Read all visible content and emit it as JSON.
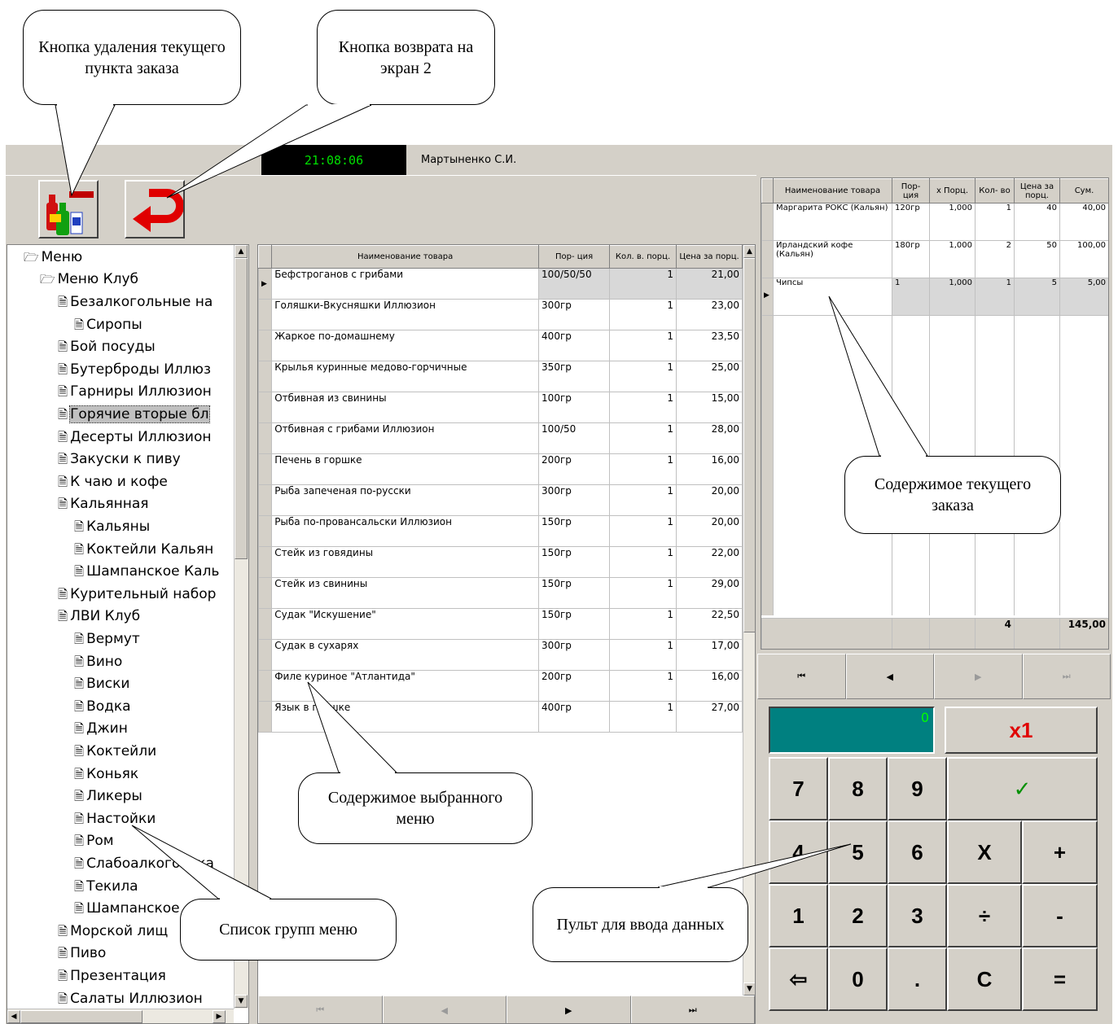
{
  "header": {
    "clock": "21:08:06",
    "user": "Мартыненко С.И."
  },
  "toolbar": {
    "delete_icon": "bottles-minus-icon",
    "back_icon": "red-return-arrow-icon"
  },
  "tree": {
    "root": "Меню",
    "club": "Меню Клуб",
    "items": [
      {
        "label": "Безалкогольные на",
        "level": 2
      },
      {
        "label": "Сиропы",
        "level": 3
      },
      {
        "label": "Бой посуды",
        "level": 2
      },
      {
        "label": "Бутерброды Иллюз",
        "level": 2
      },
      {
        "label": "Гарниры Иллюзион",
        "level": 2
      },
      {
        "label": "Горячие вторые бл",
        "level": 2,
        "selected": true
      },
      {
        "label": "Десерты Иллюзион",
        "level": 2
      },
      {
        "label": "Закуски к пиву",
        "level": 2
      },
      {
        "label": "К чаю и кофе",
        "level": 2
      },
      {
        "label": "Кальянная",
        "level": 2
      },
      {
        "label": "Кальяны",
        "level": 3
      },
      {
        "label": "Коктейли Кальян",
        "level": 3
      },
      {
        "label": "Шампанское Каль",
        "level": 3
      },
      {
        "label": "Курительный набор",
        "level": 2
      },
      {
        "label": "ЛВИ Клуб",
        "level": 2
      },
      {
        "label": "Вермут",
        "level": 3
      },
      {
        "label": "Вино",
        "level": 3
      },
      {
        "label": "Виски",
        "level": 3
      },
      {
        "label": "Водка",
        "level": 3
      },
      {
        "label": "Джин",
        "level": 3
      },
      {
        "label": "Коктейли",
        "level": 3
      },
      {
        "label": "Коньяк",
        "level": 3
      },
      {
        "label": "Ликеры",
        "level": 3
      },
      {
        "label": "Настойки",
        "level": 3
      },
      {
        "label": "Ром",
        "level": 3
      },
      {
        "label": "Слабоалкоголька",
        "level": 3
      },
      {
        "label": "Текила",
        "level": 3
      },
      {
        "label": "Шампанское",
        "level": 3
      },
      {
        "label": "Морской лищ",
        "level": 2
      },
      {
        "label": "Пиво",
        "level": 2
      },
      {
        "label": "Презентация",
        "level": 2
      },
      {
        "label": "Салаты Иллюзион",
        "level": 2
      }
    ]
  },
  "menu": {
    "columns": [
      "Наименование товара",
      "Пор- ция",
      "Кол. в. порц.",
      "Цена за порц."
    ],
    "rows": [
      [
        "Бефстроганов с грибами",
        "100/50/50",
        "1",
        "21,00"
      ],
      [
        "Голяшки-Вкусняшки Иллюзион",
        "300гр",
        "1",
        "23,00"
      ],
      [
        "Жаркое по-домашнему",
        "400гр",
        "1",
        "23,50"
      ],
      [
        "Крылья куринные медово-горчичные",
        "350гр",
        "1",
        "25,00"
      ],
      [
        "Отбивная из свинины",
        "100гр",
        "1",
        "15,00"
      ],
      [
        "Отбивная с грибами Иллюзион",
        "100/50",
        "1",
        "28,00"
      ],
      [
        "Печень в горшке",
        "200гр",
        "1",
        "16,00"
      ],
      [
        "Рыба запеченая по-русски",
        "300гр",
        "1",
        "20,00"
      ],
      [
        "Рыба по-провансальски Иллюзион",
        "150гр",
        "1",
        "20,00"
      ],
      [
        "Стейк из говядины",
        "150гр",
        "1",
        "22,00"
      ],
      [
        "Стейк из свинины",
        "150гр",
        "1",
        "29,00"
      ],
      [
        "Судак \"Искушение\"",
        "150гр",
        "1",
        "22,50"
      ],
      [
        "Судак в сухарях",
        "300гр",
        "1",
        "17,00"
      ],
      [
        "Филе куриное \"Атлантида\"",
        "200гр",
        "1",
        "16,00"
      ],
      [
        "Язык в горшке",
        "400гр",
        "1",
        "27,00"
      ]
    ]
  },
  "order": {
    "columns": [
      "Наименование товара",
      "Пор- ция",
      "х Порц.",
      "Кол- во",
      "Цена за порц.",
      "Сум."
    ],
    "rows": [
      [
        "Маргарита РОКС (Кальян)",
        "120гр",
        "1,000",
        "1",
        "40",
        "40,00"
      ],
      [
        "Ирландский кофе (Кальян)",
        "180гр",
        "1,000",
        "2",
        "50",
        "100,00"
      ],
      [
        "Чипсы",
        "1",
        "1,000",
        "1",
        "5",
        "5,00"
      ]
    ],
    "total_qty": "4",
    "total_sum": "145,00"
  },
  "keypad": {
    "display": "0",
    "multiplier": "x1",
    "keys": [
      "7",
      "8",
      "9",
      "✓",
      "4",
      "5",
      "6",
      "X",
      "+",
      "1",
      "2",
      "3",
      "÷",
      "-",
      "⇦",
      "0",
      ".",
      "C",
      "="
    ]
  },
  "nav": {
    "first": "⏮",
    "prev": "◀",
    "next": "▶",
    "last": "⏭"
  },
  "callouts": {
    "delete": "Кнопка удаления текущего пункта заказа",
    "back": "Кнопка возврата на экран 2",
    "order": "Содержимое текущего заказа",
    "menu": "Содержимое выбранного меню",
    "keypad": "Пульт для ввода данных",
    "groups": "Список групп меню"
  },
  "colors": {
    "clock_text": "#00e000",
    "display_bg": "#008080",
    "accent_red": "#e00000",
    "check_green": "#009000"
  }
}
